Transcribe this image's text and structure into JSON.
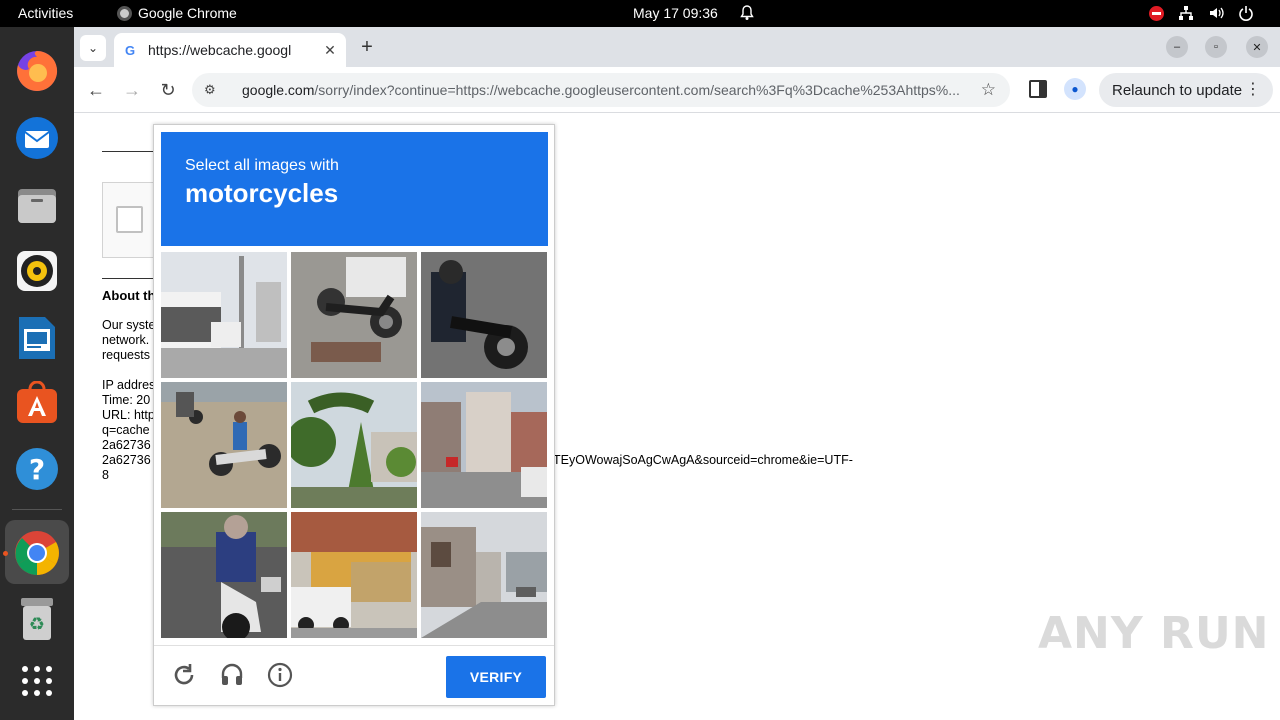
{
  "topbar": {
    "activities": "Activities",
    "app_name": "Google Chrome",
    "clock": "May 17  09:36"
  },
  "dock": {
    "items": [
      "firefox-icon",
      "thunderbird-icon",
      "files-icon",
      "rhythmbox-icon",
      "libreoffice-impress-icon",
      "app-center-icon",
      "help-icon",
      "chrome-icon",
      "trash-icon",
      "show-apps-icon"
    ]
  },
  "browser": {
    "tab_title": "https://webcache.googl",
    "url_domain": "google.com",
    "url_rest": "/sorry/index?continue=https://webcache.googleusercontent.com/search%3Fq%3Dcache%253Ahttps%...",
    "relaunch_label": "Relaunch to update"
  },
  "page": {
    "about_heading": "About th",
    "lines": [
      "Our syste",
      "network.",
      "requests",
      "",
      "IP addres",
      "Time: 20",
      "URL: http",
      "q=cache",
      "2a62736",
      "2a62736",
      "8"
    ],
    "overflow_text": "TEyOWowajSoAgCwAgA&sourceid=chrome&ie=UTF-"
  },
  "captcha": {
    "instruction": "Select all images with",
    "target": "motorcycles",
    "verify_label": "VERIFY",
    "tiles": [
      "street-with-building-and-truck",
      "motorcycle-crash-on-road",
      "rider-on-dark-motorcycle",
      "riders-on-motorcycles-dirt-road",
      "trees-and-house",
      "street-corner-with-shops",
      "rider-on-white-scooter",
      "building-with-white-car",
      "alley-with-houses"
    ]
  },
  "watermark": "ANY RUN"
}
